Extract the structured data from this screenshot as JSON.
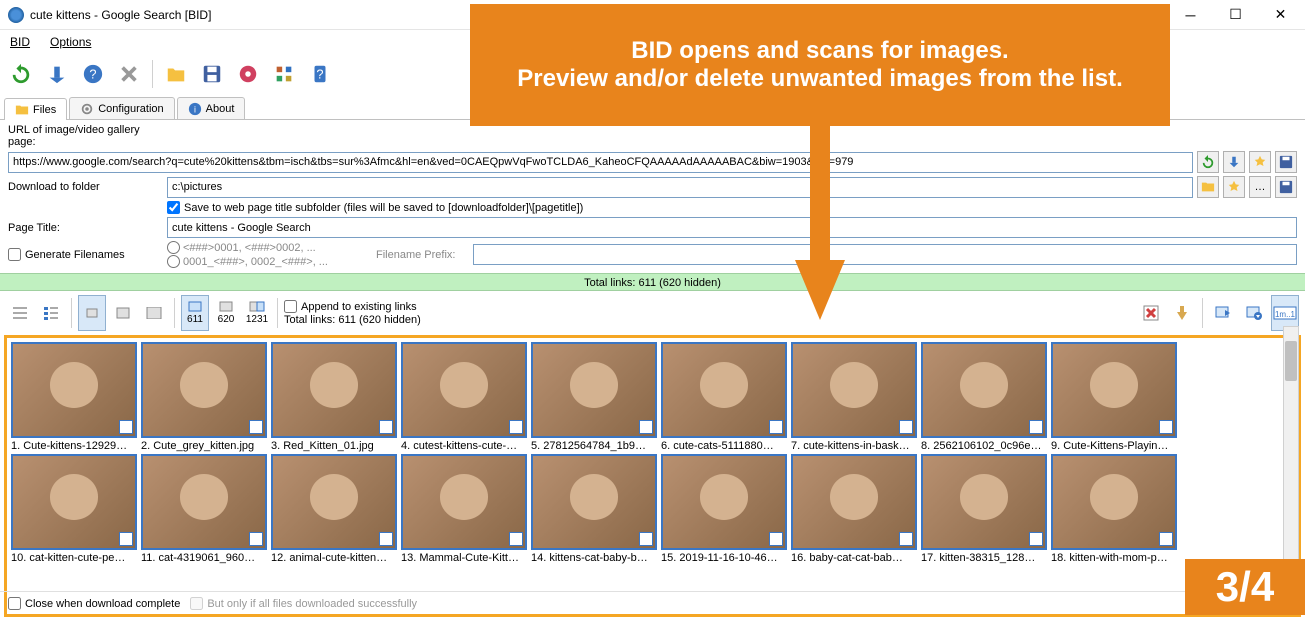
{
  "window": {
    "title": "cute kittens - Google Search [BID]"
  },
  "menu": {
    "bid": "BID",
    "options": "Options"
  },
  "tabs": {
    "files": "Files",
    "configuration": "Configuration",
    "about": "About"
  },
  "form": {
    "url_label": "URL of image/video gallery page:",
    "url_value": "https://www.google.com/search?q=cute%20kittens&tbm=isch&tbs=sur%3Afmc&hl=en&ved=0CAEQpwVqFwoTCLDA6_KaheoCFQAAAAAdAAAAABAC&biw=1903&bih=979",
    "download_label": "Download to folder",
    "download_value": "c:\\pictures",
    "save_subfolder_label": "Save to web page title subfolder (files will be saved to [downloadfolder]\\[pagetitle])",
    "page_title_label": "Page Title:",
    "page_title_value": "cute kittens - Google Search",
    "generate_filenames_label": "Generate Filenames",
    "pattern1": "<###>0001, <###>0002, ...",
    "pattern2": "0001_<###>, 0002_<###>, ...",
    "filename_prefix_label": "Filename Prefix:",
    "filename_prefix_value": ""
  },
  "status": {
    "total_links": "Total links: 611 (620 hidden)"
  },
  "viewbar": {
    "count1": "611",
    "count2": "620",
    "count3": "1231",
    "append_label": "Append to existing links",
    "total_links2": "Total links: 611 (620 hidden)"
  },
  "thumbs": [
    {
      "label": "1. Cute-kittens-12929…"
    },
    {
      "label": "2. Cute_grey_kitten.jpg"
    },
    {
      "label": "3. Red_Kitten_01.jpg"
    },
    {
      "label": "4. cutest-kittens-cute-…"
    },
    {
      "label": "5. 27812564784_1b9…"
    },
    {
      "label": "6. cute-cats-5111880…"
    },
    {
      "label": "7. cute-kittens-in-bask…"
    },
    {
      "label": "8. 2562106102_0c96e…"
    },
    {
      "label": "9. Cute-Kittens-Playin…"
    },
    {
      "label": "10. cat-kitten-cute-pe…"
    },
    {
      "label": "11. cat-4319061_960…"
    },
    {
      "label": "12. animal-cute-kitten…"
    },
    {
      "label": "13. Mammal-Cute-Kitt…"
    },
    {
      "label": "14. kittens-cat-baby-b…"
    },
    {
      "label": "15. 2019-11-16-10-46…"
    },
    {
      "label": "16. baby-cat-cat-bab…"
    },
    {
      "label": "17. kitten-38315_128…"
    },
    {
      "label": "18. kitten-with-mom-p…"
    }
  ],
  "bottom": {
    "close_label": "Close when download complete",
    "but_only_label": "But only if all files downloaded successfully"
  },
  "overlay": {
    "line1": "BID opens and scans for images.",
    "line2": "Preview and/or delete unwanted images from the list.",
    "page_indicator": "3/4"
  }
}
